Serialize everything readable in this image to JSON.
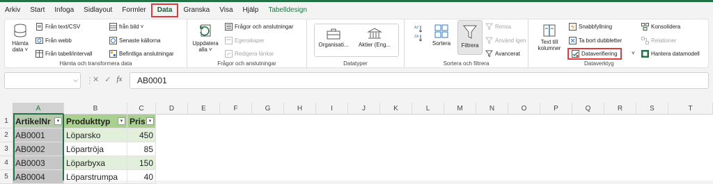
{
  "tabs": [
    "Arkiv",
    "Start",
    "Infoga",
    "Sidlayout",
    "Formler",
    "Data",
    "Granska",
    "Visa",
    "Hjälp",
    "Tabelldesign"
  ],
  "ribbon": {
    "hamta": {
      "big_label1": "Hämta",
      "big_label2": "data ˅",
      "items": [
        "Från text/CSV",
        "Från webb",
        "Från tabell/intervall",
        "från bild ˅",
        "Senaste källorna",
        "Befintliga anslutningar"
      ],
      "label": "Hämta och transformera data"
    },
    "fragor": {
      "big_label1": "Uppdatera",
      "big_label2": "alla ˅",
      "items": [
        "Frågor och anslutningar",
        "Egenskaper",
        "Redigera länkar"
      ],
      "label": "Frågor och anslutningar"
    },
    "datatyper": {
      "items": [
        "Organisati...",
        "Aktier (Eng..."
      ],
      "label": "Datatyper"
    },
    "sortera": {
      "sortera": "Sortera",
      "filtrera": "Filtrera",
      "items": [
        "Rensa",
        "Använd igen",
        "Avancerat"
      ],
      "label": "Sortera och filtrera"
    },
    "verktyg": {
      "big_label1": "Text till",
      "big_label2": "kolumner",
      "items": [
        "Snabbfyllning",
        "Ta bort dubbletter",
        "Dataverifiering",
        "Konsolidera",
        "Relationer",
        "Hantera datamodell"
      ],
      "label": "Dataverktyg"
    }
  },
  "formula_bar": {
    "name_box": "",
    "fx": "fx",
    "content": "AB0001"
  },
  "columns": [
    "A",
    "B",
    "C",
    "D",
    "E",
    "F",
    "G",
    "H",
    "I",
    "J",
    "K",
    "L",
    "M",
    "N",
    "O",
    "P",
    "Q",
    "R",
    "S",
    "T"
  ],
  "rows": [
    "1",
    "2",
    "3",
    "4",
    "5"
  ],
  "table": {
    "headers": [
      "ArtikelNr",
      "Produkttyp",
      "Pris"
    ],
    "data": [
      [
        "AB0001",
        "Löparsko",
        "450"
      ],
      [
        "AB0002",
        "Löpartröja",
        "85"
      ],
      [
        "AB0003",
        "Löparbyxa",
        "150"
      ],
      [
        "AB0004",
        "Löparstrumpa",
        "40"
      ]
    ]
  },
  "colors": {
    "accent": "#217346",
    "highlight": "#e0393e",
    "header_fill": "#a9d08e",
    "band_fill": "#e2efda"
  }
}
